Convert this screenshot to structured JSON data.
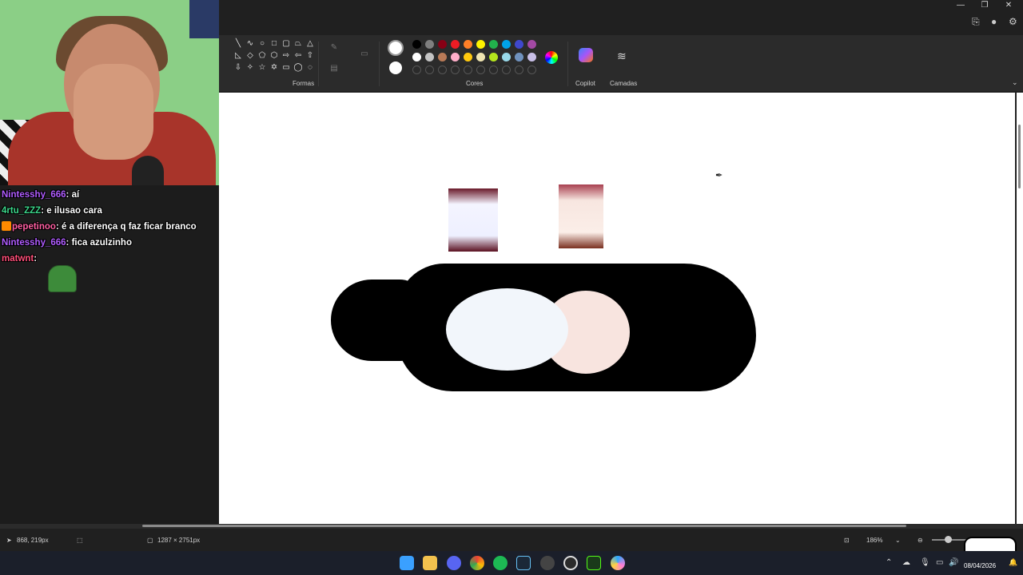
{
  "ribbon": {
    "shapes_label": "Formas",
    "colors_label": "Cores",
    "copilot_label": "Copilot",
    "layers_label": "Camadas",
    "swatch_colors_row1": [
      "#000000",
      "#7f7f7f",
      "#880015",
      "#ed1c24",
      "#ff7f27",
      "#fff200",
      "#22b14c",
      "#00a2e8",
      "#3f48cc",
      "#a349a4"
    ],
    "swatch_colors_row2": [
      "#ffffff",
      "#c3c3c3",
      "#b97a57",
      "#ffaec9",
      "#ffc90e",
      "#efe4b0",
      "#b5e61d",
      "#99d9ea",
      "#7092be",
      "#c8bfe7"
    ]
  },
  "chat": {
    "messages": [
      {
        "user": "Nintesshy_666",
        "user_color": "#b05cff",
        "text": "aí"
      },
      {
        "user": "4rtu_ZZZ",
        "user_color": "#3cd68a",
        "text": "e ilusao cara"
      },
      {
        "user": "pepetinoo",
        "user_color": "#ff5fa2",
        "text": "é a diferença q faz ficar branco"
      },
      {
        "user": "Nintesshy_666",
        "user_color": "#b05cff",
        "text": "fica azulzinho"
      },
      {
        "user": "matwnt",
        "user_color": "#ff4f79",
        "text": ""
      }
    ]
  },
  "status": {
    "cursor_pos": "868, 219px",
    "canvas_size": "1287 × 2751px",
    "zoom": "186%"
  },
  "taskbar": {
    "date": "08/04/2026"
  }
}
